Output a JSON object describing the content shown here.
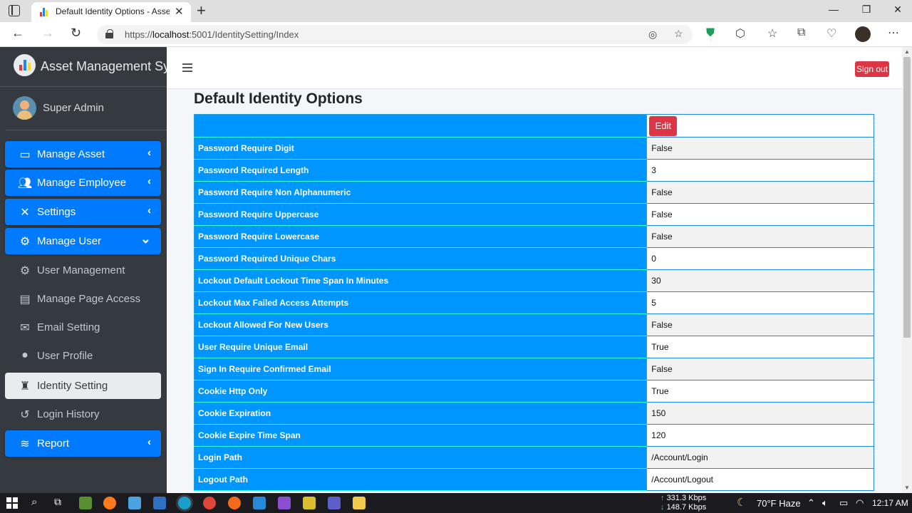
{
  "browser": {
    "tab_title": "Default Identity Options - Asset Management System",
    "url_prefix": "https://",
    "url_host": "localhost",
    "url_path": ":5001/IdentitySetting/Index"
  },
  "sidebar": {
    "brand": "Asset Management System",
    "user": "Super Admin",
    "items": [
      {
        "label": "Manage Asset",
        "icon": "box-open-icon",
        "style": "primary",
        "caret": "‹"
      },
      {
        "label": "Manage Employee",
        "icon": "users-icon",
        "style": "primary",
        "caret": "‹"
      },
      {
        "label": "Settings",
        "icon": "tools-icon",
        "style": "primary",
        "caret": "‹"
      },
      {
        "label": "Manage User",
        "icon": "user-cog-icon",
        "style": "primary",
        "caret": "⌄"
      },
      {
        "label": "User Management",
        "icon": "user-gear-icon",
        "style": "plain",
        "caret": ""
      },
      {
        "label": "Manage Page Access",
        "icon": "toolbox-icon",
        "style": "plain",
        "caret": ""
      },
      {
        "label": "Email Setting",
        "icon": "envelope-icon",
        "style": "plain",
        "caret": ""
      },
      {
        "label": "User Profile",
        "icon": "user-circle-icon",
        "style": "plain",
        "caret": ""
      },
      {
        "label": "Identity Setting",
        "icon": "user-secret-icon",
        "style": "active",
        "caret": ""
      },
      {
        "label": "Login History",
        "icon": "history-icon",
        "style": "plain",
        "caret": ""
      },
      {
        "label": "Report",
        "icon": "database-icon",
        "style": "primary",
        "caret": "‹"
      }
    ]
  },
  "header": {
    "signout_label": "Sign out"
  },
  "main": {
    "title": "Default Identity Options",
    "edit_label": "Edit",
    "rows": [
      {
        "key": "Password Require Digit",
        "value": "False"
      },
      {
        "key": "Password Required Length",
        "value": "3"
      },
      {
        "key": "Password Require Non Alphanumeric",
        "value": "False"
      },
      {
        "key": "Password Require Uppercase",
        "value": "False"
      },
      {
        "key": "Password Require Lowercase",
        "value": "False"
      },
      {
        "key": "Password Required Unique Chars",
        "value": "0"
      },
      {
        "key": "Lockout Default Lockout Time Span In Minutes",
        "value": "30"
      },
      {
        "key": "Lockout Max Failed Access Attempts",
        "value": "5"
      },
      {
        "key": "Lockout Allowed For New Users",
        "value": "False"
      },
      {
        "key": "User Require Unique Email",
        "value": "True"
      },
      {
        "key": "Sign In Require Confirmed Email",
        "value": "False"
      },
      {
        "key": "Cookie Http Only",
        "value": "True"
      },
      {
        "key": "Cookie Expiration",
        "value": "150"
      },
      {
        "key": "Cookie Expire Time Span",
        "value": "120"
      },
      {
        "key": "Login Path",
        "value": "/Account/Login"
      },
      {
        "key": "Logout Path",
        "value": "/Account/Logout"
      }
    ]
  },
  "taskbar": {
    "upload": "331.3 Kbps",
    "download": "148.7 Kbps",
    "weather": "70°F  Haze",
    "time": "12:17 AM"
  },
  "colors": {
    "sidebar_bg": "#343a40",
    "primary": "#007bff",
    "danger": "#dc3545",
    "table_key_bg": "#0096ff"
  }
}
